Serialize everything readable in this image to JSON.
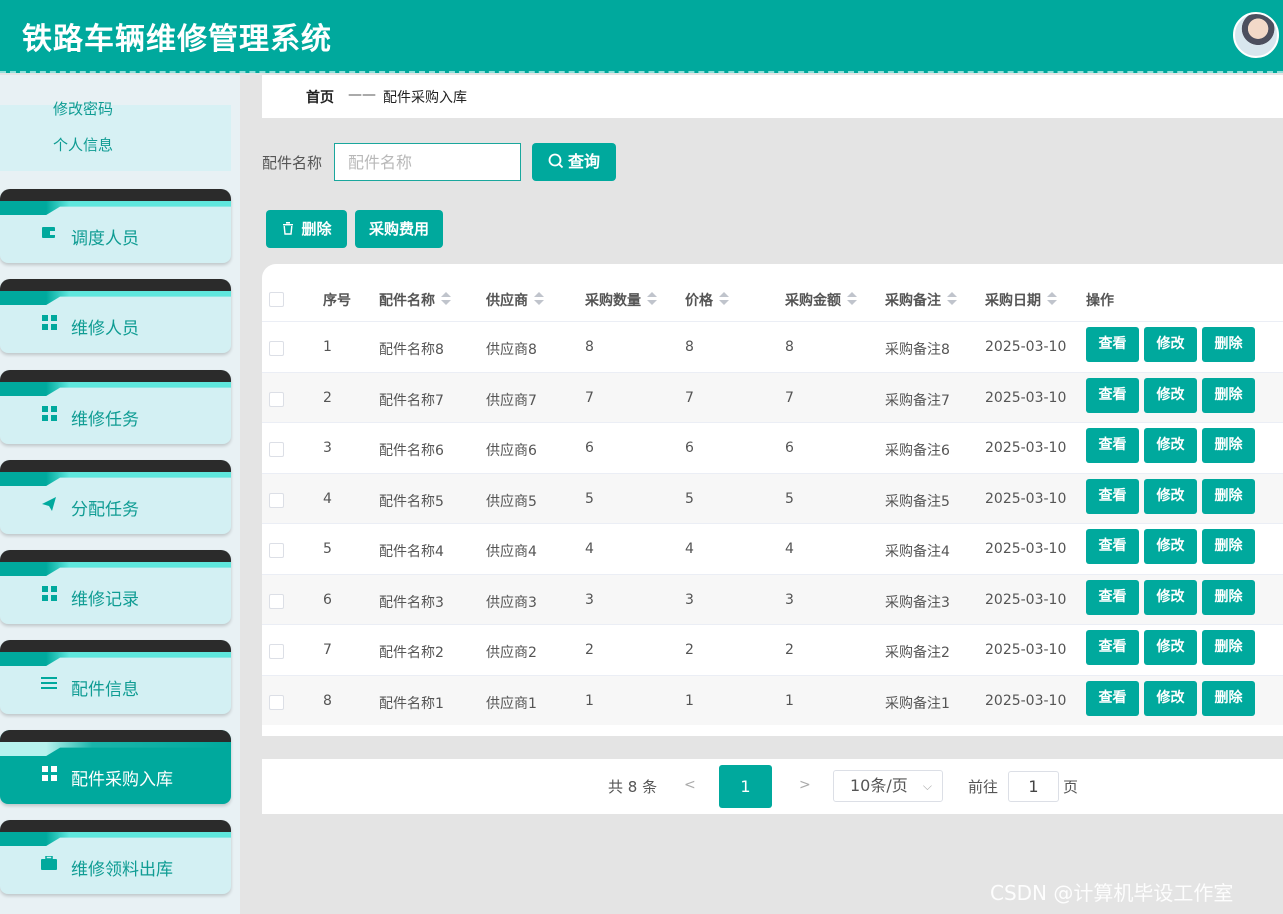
{
  "app": {
    "title": "铁路车辆维修管理系统"
  },
  "sidebar": {
    "sub_items": [
      "修改密码",
      "个人信息"
    ],
    "menu": [
      {
        "label": "调度人员",
        "icon": "wallet-icon",
        "active": false
      },
      {
        "label": "维修人员",
        "icon": "grid-icon",
        "active": false
      },
      {
        "label": "维修任务",
        "icon": "grid-icon",
        "active": false
      },
      {
        "label": "分配任务",
        "icon": "send-icon",
        "active": false
      },
      {
        "label": "维修记录",
        "icon": "grid-icon",
        "active": false
      },
      {
        "label": "配件信息",
        "icon": "list-icon",
        "active": false
      },
      {
        "label": "配件采购入库",
        "icon": "grid-icon",
        "active": true
      },
      {
        "label": "维修领料出库",
        "icon": "briefcase-icon",
        "active": false
      }
    ]
  },
  "breadcrumb": {
    "home": "首页",
    "sep": "——",
    "current": "配件采购入库"
  },
  "search": {
    "label": "配件名称",
    "placeholder": "配件名称",
    "value": "",
    "button": "查询"
  },
  "toolbar": {
    "delete_label": "删除",
    "cost_label": "采购费用"
  },
  "table": {
    "headers": [
      "序号",
      "配件名称",
      "供应商",
      "采购数量",
      "价格",
      "采购金额",
      "采购备注",
      "采购日期",
      "操作"
    ],
    "rows": [
      [
        "1",
        "配件名称8",
        "供应商8",
        "8",
        "8",
        "8",
        "采购备注8",
        "2025-03-10"
      ],
      [
        "2",
        "配件名称7",
        "供应商7",
        "7",
        "7",
        "7",
        "采购备注7",
        "2025-03-10"
      ],
      [
        "3",
        "配件名称6",
        "供应商6",
        "6",
        "6",
        "6",
        "采购备注6",
        "2025-03-10"
      ],
      [
        "4",
        "配件名称5",
        "供应商5",
        "5",
        "5",
        "5",
        "采购备注5",
        "2025-03-10"
      ],
      [
        "5",
        "配件名称4",
        "供应商4",
        "4",
        "4",
        "4",
        "采购备注4",
        "2025-03-10"
      ],
      [
        "6",
        "配件名称3",
        "供应商3",
        "3",
        "3",
        "3",
        "采购备注3",
        "2025-03-10"
      ],
      [
        "7",
        "配件名称2",
        "供应商2",
        "2",
        "2",
        "2",
        "采购备注2",
        "2025-03-10"
      ],
      [
        "8",
        "配件名称1",
        "供应商1",
        "1",
        "1",
        "1",
        "采购备注1",
        "2025-03-10"
      ]
    ],
    "row_actions": [
      "查看",
      "修改",
      "删除"
    ]
  },
  "pagination": {
    "total": "共 8 条",
    "prev": "<",
    "current_page": "1",
    "next": ">",
    "page_size": "10条/页",
    "goto_label": "前往",
    "goto_value": "1",
    "goto_unit": "页"
  },
  "watermark": "CSDN @计算机毕设工作室",
  "colors": {
    "primary": "#00a99d",
    "header_bg": "#00a99d",
    "sidebar_bg": "#e8f1f4",
    "menu_card_bg": "#d3f0f3",
    "content_bg": "#e4e4e4"
  }
}
